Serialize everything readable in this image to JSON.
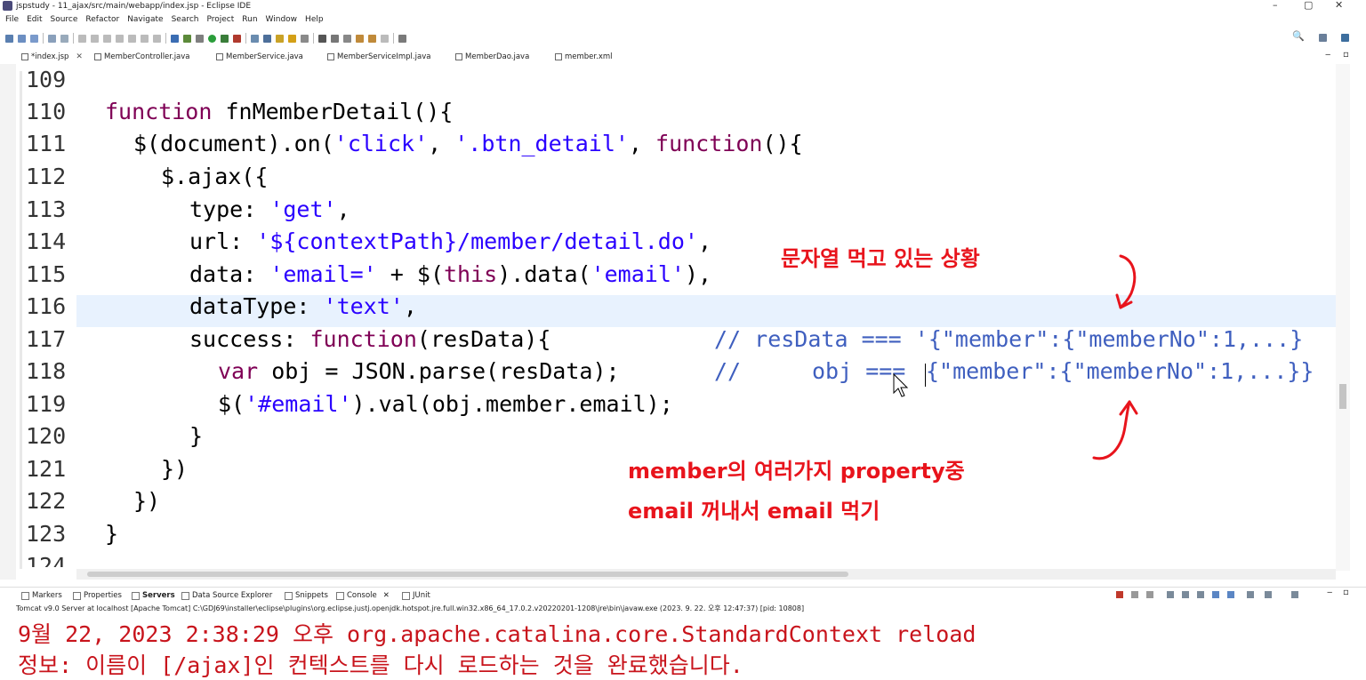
{
  "window": {
    "title": "jspstudy - 11_ajax/src/main/webapp/index.jsp - Eclipse IDE",
    "min_glyph": "–",
    "max_glyph": "▢",
    "close_glyph": "✕"
  },
  "menu": [
    "File",
    "Edit",
    "Source",
    "Refactor",
    "Navigate",
    "Search",
    "Project",
    "Run",
    "Window",
    "Help"
  ],
  "toolbar": {
    "search_glyph": "🔍",
    "colors": [
      "#4a7fc1",
      "#6b8e23",
      "#c0392b",
      "#d4a017",
      "#2e8b57",
      "#8e44ad",
      "#16a085",
      "#e67e22"
    ]
  },
  "tabs": [
    {
      "label": "*index.jsp",
      "close": "✕"
    },
    {
      "label": "MemberController.java"
    },
    {
      "label": "MemberService.java"
    },
    {
      "label": "MemberServiceImpl.java"
    },
    {
      "label": "MemberDao.java"
    },
    {
      "label": "member.xml"
    }
  ],
  "code": {
    "lines": [
      {
        "num": "109",
        "text": ""
      },
      {
        "num": "110",
        "text": "function fnMemberDetail(){"
      },
      {
        "num": "111",
        "text": "$(document).on('click', '.btn_detail', function(){"
      },
      {
        "num": "112",
        "text": "$.ajax({"
      },
      {
        "num": "113",
        "text": "type: 'get',"
      },
      {
        "num": "114",
        "text": "url: '${contextPath}/member/detail.do',"
      },
      {
        "num": "115",
        "text": "data: 'email=' + $(this).data('email'),"
      },
      {
        "num": "116",
        "text": "dataType: 'text',"
      },
      {
        "num": "117",
        "text": "success: function(resData){"
      },
      {
        "num": "118",
        "text": "var obj = JSON.parse(resData);"
      },
      {
        "num": "119",
        "text": "$('#email').val(obj.member.email);"
      },
      {
        "num": "120",
        "text": "}"
      },
      {
        "num": "121",
        "text": "})"
      },
      {
        "num": "122",
        "text": "})"
      },
      {
        "num": "123",
        "text": "}"
      },
      {
        "num": "124",
        "text": ""
      }
    ],
    "comment_117": "// resData === '{\"member\":{\"memberNo\":1,...}",
    "comment_118_prefix": "//",
    "comment_118_var": "obj ===",
    "comment_118_value": "{\"member\":{\"memberNo\":1,...}}"
  },
  "annotations": {
    "top": "문자열 먹고 있는 상황",
    "bottom_line1": "member의 여러가지 property중",
    "bottom_line2": "email 꺼내서 email 먹기"
  },
  "panel_tabs": [
    "Markers",
    "Properties",
    "Servers",
    "Data Source Explorer",
    "Snippets",
    "Console",
    "JUnit"
  ],
  "console": {
    "header": "Tomcat v9.0 Server at localhost [Apache Tomcat] C:\\GDJ69\\installer\\eclipse\\plugins\\org.eclipse.justj.openjdk.hotspot.jre.full.win32.x86_64_17.0.2.v20220201-1208\\jre\\bin\\javaw.exe  (2023. 9. 22. 오후 12:47:37) [pid: 10808]",
    "line1": "9월 22, 2023 2:38:29 오후 org.apache.catalina.core.StandardContext reload",
    "line2": "정보: 이름이 [/ajax]인 컨텍스트를 다시 로드하는 것을 완료했습니다."
  }
}
